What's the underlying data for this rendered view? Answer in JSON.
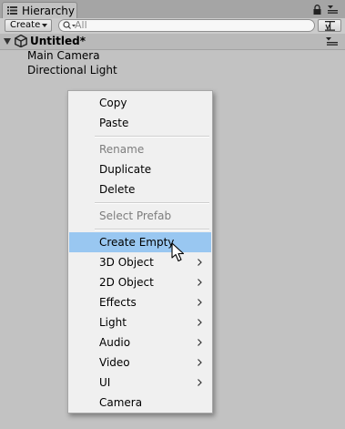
{
  "tab": {
    "label": "Hierarchy"
  },
  "toolbar": {
    "create_label": "Create",
    "search_placeholder": "All"
  },
  "scene": {
    "title": "Untitled*"
  },
  "hierarchy": {
    "items": [
      "Main Camera",
      "Directional Light"
    ]
  },
  "context_menu": {
    "items": [
      {
        "label": "Copy"
      },
      {
        "label": "Paste"
      },
      {
        "label": "Rename",
        "disabled": true
      },
      {
        "label": "Duplicate"
      },
      {
        "label": "Delete"
      },
      {
        "label": "Select Prefab",
        "disabled": true
      },
      {
        "label": "Create Empty",
        "highlighted": true
      },
      {
        "label": "3D Object",
        "submenu": true
      },
      {
        "label": "2D Object",
        "submenu": true
      },
      {
        "label": "Effects",
        "submenu": true
      },
      {
        "label": "Light",
        "submenu": true
      },
      {
        "label": "Audio",
        "submenu": true
      },
      {
        "label": "Video",
        "submenu": true
      },
      {
        "label": "UI",
        "submenu": true
      },
      {
        "label": "Camera"
      }
    ]
  },
  "colors": {
    "highlight": "#99c7f1",
    "panel_bg": "#c2c2c2",
    "disabled_text": "#7d7d7d"
  }
}
